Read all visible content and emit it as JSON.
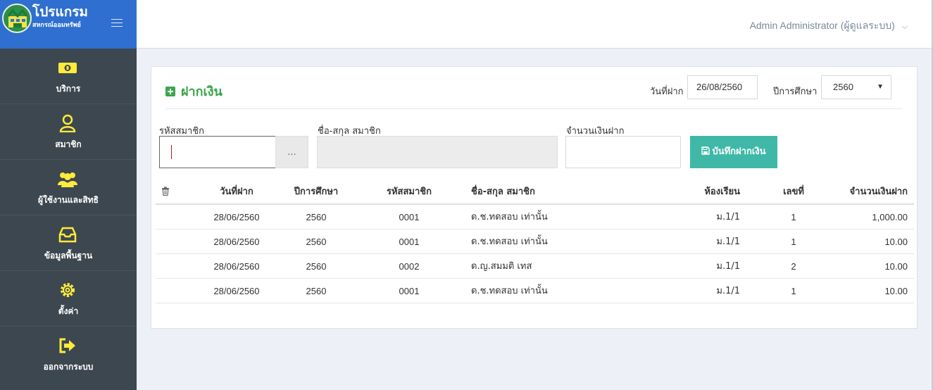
{
  "brand": {
    "title": "โปรแกรม",
    "subtitle": "สหกรณ์ออมทรัพย์"
  },
  "sidebar": {
    "items": [
      {
        "label": "บริการ",
        "icon": "money-icon"
      },
      {
        "label": "สมาชิก",
        "icon": "member-icon"
      },
      {
        "label": "ผู้ใช้งานและสิทธิ",
        "icon": "users-icon"
      },
      {
        "label": "ข้อมูลพื้นฐาน",
        "icon": "inbox-icon"
      },
      {
        "label": "ตั้งค่า",
        "icon": "gear-icon"
      },
      {
        "label": "ออกจากระบบ",
        "icon": "logout-icon"
      }
    ],
    "icon_color": "#ffeb3b"
  },
  "header": {
    "user": "Admin Administrator (ผู้ดูแลระบบ)"
  },
  "form": {
    "title": "ฝากเงิน",
    "date_label": "วันที่ฝาก",
    "date_value": "26/08/2560",
    "year_label": "ปีการศึกษา",
    "year_value": "2560",
    "member_code_label": "รหัสสมาชิก",
    "member_name_label": "ชื่อ-สกุล สมาชิก",
    "amount_label": "จำนวนเงินฝาก",
    "browse_label": "...",
    "save_label": "บันทึกฝากเงิน"
  },
  "table": {
    "headers": [
      "วันที่ฝาก",
      "ปีการศึกษา",
      "รหัสสมาชิก",
      "ชื่อ-สกุล สมาชิก",
      "ห้องเรียน",
      "เลขที่",
      "จำนวนเงินฝาก"
    ],
    "rows": [
      [
        "28/06/2560",
        "2560",
        "0001",
        "ด.ช.ทดสอบ เท่านั้น",
        "ม.1/1",
        "1",
        "1,000.00"
      ],
      [
        "28/06/2560",
        "2560",
        "0001",
        "ด.ช.ทดสอบ เท่านั้น",
        "ม.1/1",
        "1",
        "10.00"
      ],
      [
        "28/06/2560",
        "2560",
        "0002",
        "ด.ญ.สมมติ เทส",
        "ม.1/1",
        "2",
        "10.00"
      ],
      [
        "28/06/2560",
        "2560",
        "0001",
        "ด.ช.ทดสอบ เท่านั้น",
        "ม.1/1",
        "1",
        "10.00"
      ]
    ]
  },
  "colors": {
    "brand": "#2f6fd0",
    "sidebar": "#3d4750",
    "accent_green": "#3aa648",
    "save_button": "#3fb8a8"
  }
}
